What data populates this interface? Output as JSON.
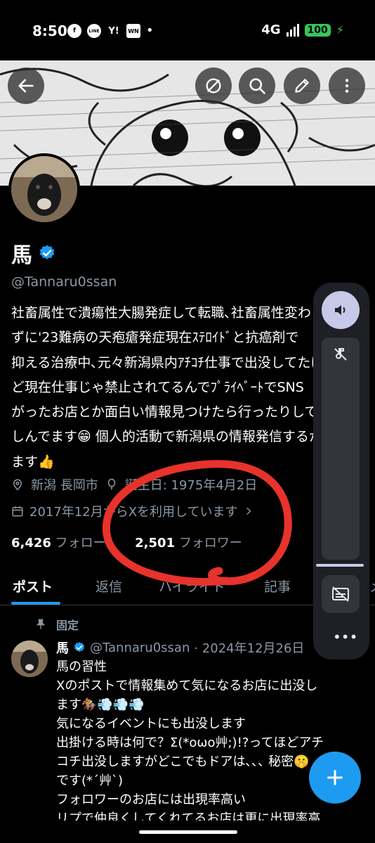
{
  "status_bar": {
    "time": "8:50",
    "apps": [
      "f",
      "LINE",
      "Y!",
      "WN"
    ],
    "network": "4G",
    "battery": "100"
  },
  "profile": {
    "name": "馬",
    "handle": "@Tannaru0ssan",
    "bio_lines": [
      "社畜属性で潰瘍性大腸発症して転職､社畜属性変わら",
      "ずに'23難病の天疱瘡発症現在ｽﾃﾛｲﾄﾞと抗癌剤で",
      "抑える治療中､元々新潟県内ｱﾁｺﾁ仕事で出没してたけ",
      "ど現在仕事じゃ禁止されてるんでﾌﾟﾗｲﾍﾞｰﾄでSNS",
      "がったお店とか面白い情報見つけたら行ったりして",
      "しんでます😁 個人的活動で新潟県の情報発信するかも",
      "ます👍"
    ],
    "location": "新潟 長岡市",
    "birthday": "誕生日: 1975年4月2日",
    "joined": "2017年12月からXを利用しています",
    "following_count": "6,426",
    "following_label": "フォロー",
    "followers_count": "2,501",
    "followers_label": "フォロワー"
  },
  "tabs": [
    {
      "label": "ポスト"
    },
    {
      "label": "返信"
    },
    {
      "label": "ハイライト"
    },
    {
      "label": "記事"
    },
    {
      "label": "メ"
    }
  ],
  "pinned_post": {
    "pinned_label": "固定",
    "author_name": "馬",
    "author_handle": "@Tannaru0ssan",
    "date": "· 2024年12月26日",
    "lines": [
      "馬の習性",
      "Xのポストで情報集めて気になるお店に出没し",
      "ます🏇💨💨💨",
      "気になるイベントにも出没します",
      "出掛ける時は何で？Σ(*oωo艸;)!?ってほどアチ",
      "コチ出没しますがどこでもドアは､､､ 秘密🤫",
      "です(*´艸`)",
      "フォロワーのお店には出現率高い",
      "リプで仲良くしてくれてるお店は更に出現率高"
    ]
  },
  "colors": {
    "accent": "#1d9bf0",
    "annotation_circle": "#e8322c",
    "volume_accent": "#c8c8e8"
  }
}
